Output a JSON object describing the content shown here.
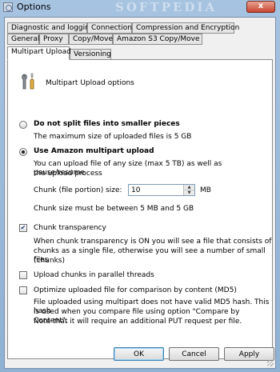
{
  "window": {
    "title": "Options",
    "watermark": "SOFTPEDIA",
    "close_symbol": "x"
  },
  "tabs": {
    "row1": [
      "Diagnostic and logging",
      "Connection",
      "Compression and Encryption"
    ],
    "row2": [
      "General",
      "Proxy",
      "Copy/Move",
      "Amazon S3 Copy/Move"
    ],
    "row3": [
      "Multipart Upload",
      "Versioning"
    ],
    "active": "Multipart Upload"
  },
  "panel": {
    "header": "Multipart Upload options",
    "no_split": {
      "label": "Do not split files into smaller pieces",
      "selected": false,
      "desc": "The maximum size of uploaded files is 5 GB"
    },
    "multipart": {
      "label": "Use Amazon multipart upload",
      "selected": true,
      "desc_line1": "You can upload file of any size (max 5 TB) as well as pause/resume",
      "desc_line2": "the upload process"
    },
    "chunk": {
      "label": "Chunk (file portion) size:",
      "value": "10",
      "unit": "MB",
      "hint": "Chunk size must be between 5 MB and 5 GB"
    },
    "transparency": {
      "label": "Chunk transparency",
      "checked": true,
      "desc_line1": "When chunk transparency is ON you will see a file that consists of",
      "desc_line2": "chunks as a single file, otherwise you will see a number of small files",
      "desc_line3": "(chunks)"
    },
    "parallel": {
      "label": "Upload chunks in parallel threads",
      "checked": false
    },
    "md5": {
      "label": "Optimize uploaded file for comparison by content (MD5)",
      "checked": false,
      "desc_line1": "File uploaded using multipart does not have valid MD5 hash. This hash",
      "desc_line2": "is used when you compare file using option \"Compare by Content\".",
      "desc_line3": "Note that it will require an additional PUT request per file."
    }
  },
  "buttons": {
    "ok": "OK",
    "cancel": "Cancel",
    "apply": "Apply"
  }
}
